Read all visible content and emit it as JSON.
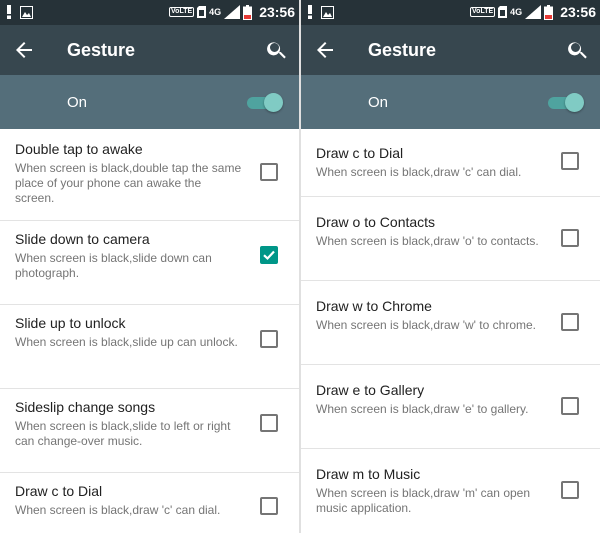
{
  "colors": {
    "statusbar": "#263238",
    "appbar": "#37474f",
    "switchbar": "#546e7a",
    "accent": "#009688"
  },
  "status": {
    "volte": "VoLTE",
    "network": "4G",
    "time": "23:56"
  },
  "header": {
    "title": "Gesture",
    "back_icon": "arrow-back-icon",
    "search_icon": "search-icon"
  },
  "master_switch": {
    "label": "On",
    "enabled": true
  },
  "left_list": [
    {
      "title": "Double tap to awake",
      "subtitle": "When screen is black,double tap the same place of your phone can awake the screen.",
      "checked": false
    },
    {
      "title": "Slide down to camera",
      "subtitle": "When screen is black,slide down can photograph.",
      "checked": true
    },
    {
      "title": "Slide up to unlock",
      "subtitle": "When screen is black,slide up can unlock.",
      "checked": false
    },
    {
      "title": "Sideslip change songs",
      "subtitle": "When screen is black,slide to left or right can change-over music.",
      "checked": false
    },
    {
      "title": "Draw c to Dial",
      "subtitle": "When screen is black,draw 'c' can dial.",
      "checked": false
    }
  ],
  "right_list": [
    {
      "title": "Draw c to Dial",
      "subtitle": "When screen is black,draw 'c' can dial.",
      "checked": false
    },
    {
      "title": "Draw o to Contacts",
      "subtitle": "When screen is black,draw 'o' to contacts.",
      "checked": false
    },
    {
      "title": "Draw w to Chrome",
      "subtitle": "When screen is black,draw 'w' to chrome.",
      "checked": false
    },
    {
      "title": "Draw e to Gallery",
      "subtitle": "When screen is black,draw 'e' to gallery.",
      "checked": false
    },
    {
      "title": "Draw m to Music",
      "subtitle": "When screen is black,draw 'm' can open music application.",
      "checked": false
    }
  ]
}
